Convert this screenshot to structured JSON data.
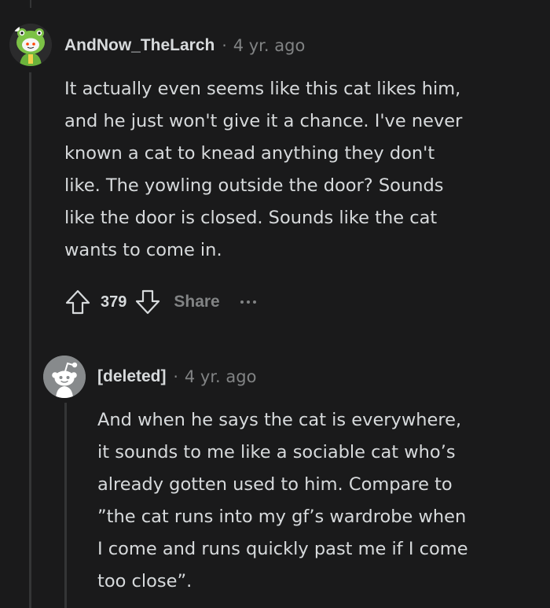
{
  "comments": [
    {
      "author": "AndNow_TheLarch",
      "separator": "·",
      "age": "4 yr. ago",
      "avatar_icon": "frog-hood-snoo-avatar",
      "body_lines": [
        "It actually even seems like this cat likes him,",
        "and he just won't give it a chance. I've never",
        "known a cat to knead anything they don't",
        "like. The yowling outside the door? Sounds",
        "like the door is closed. Sounds like the cat",
        "wants to come in."
      ],
      "score": "379",
      "share_label": "Share"
    },
    {
      "author": "[deleted]",
      "separator": "·",
      "age": "4 yr. ago",
      "avatar_icon": "default-snoo-avatar",
      "body_lines": [
        "And when he says the cat is everywhere,",
        "it sounds to me like a sociable cat who’s",
        "already gotten used to him. Compare to",
        "”the cat runs into my gf’s wardrobe when",
        "I come and runs quickly past me if I come",
        "too close”."
      ]
    }
  ],
  "icons": {
    "upvote": "upvote-arrow-icon",
    "downvote": "downvote-arrow-icon",
    "more": "more-options-icon"
  },
  "colors": {
    "background": "#1a1a1b",
    "text": "#d7dadc",
    "muted": "#818384",
    "thread_line": "#343536"
  }
}
